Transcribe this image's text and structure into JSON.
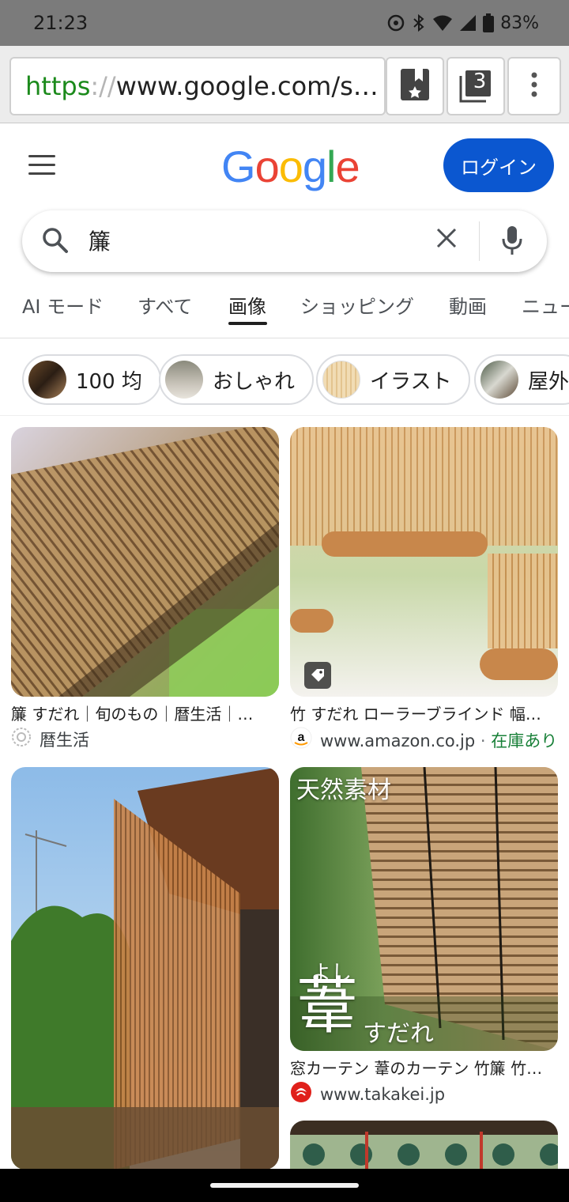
{
  "status_bar": {
    "time": "21:23",
    "battery": "83%"
  },
  "browser": {
    "url_scheme": "https",
    "url_sep": "://",
    "url_rest": "www.google.com/sear...",
    "tab_count": "3"
  },
  "header": {
    "logo_letters": [
      "G",
      "o",
      "o",
      "g",
      "l",
      "e"
    ],
    "login_label": "ログイン"
  },
  "search": {
    "query": "簾"
  },
  "tabs": [
    {
      "label": "AI モード"
    },
    {
      "label": "すべて"
    },
    {
      "label": "画像"
    },
    {
      "label": "ショッピング"
    },
    {
      "label": "動画"
    },
    {
      "label": "ニュー"
    }
  ],
  "active_tab": "画像",
  "chips": [
    {
      "label": "100 均"
    },
    {
      "label": "おしゃれ"
    },
    {
      "label": "イラスト"
    },
    {
      "label": "屋外"
    }
  ],
  "results": [
    {
      "title": "簾 すだれ｜旬のもの｜暦生活｜…",
      "source": "暦生活",
      "stock": ""
    },
    {
      "title": "竹 すだれ ローラーブラインド 幅…",
      "source": "www.amazon.co.jp",
      "stock_sep": " · ",
      "stock": "在庫あり"
    },
    {
      "title": "",
      "source": "",
      "stock": ""
    },
    {
      "title": "窓カーテン 葦のカーテン 竹簾 竹…",
      "source": "www.takakei.jp",
      "stock": "",
      "overlay_top": "天然素材",
      "overlay_ruby": "よし",
      "overlay_big": "葦",
      "overlay_small": "すだれ"
    }
  ],
  "colors": {
    "login": "#0b57d0",
    "stock": "#188038",
    "google_blue": "#4285f4",
    "google_red": "#ea4335",
    "google_yellow": "#fbbc05",
    "google_green": "#34a853"
  }
}
